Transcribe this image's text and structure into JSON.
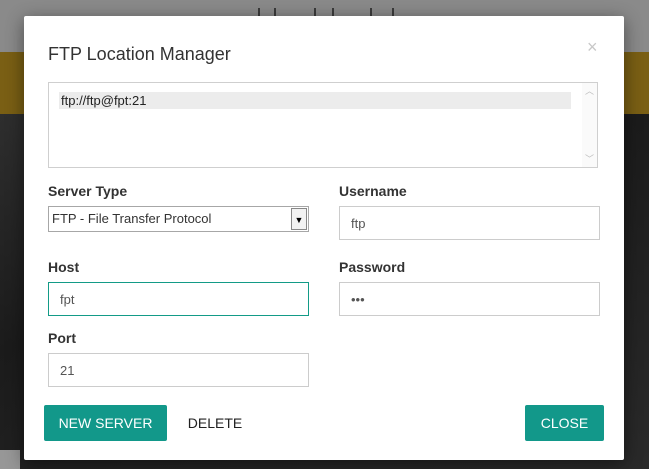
{
  "modal": {
    "title": "FTP Location Manager",
    "close_glyph": "×"
  },
  "locations": [
    "ftp://ftp@fpt:21"
  ],
  "form": {
    "server_type": {
      "label": "Server Type",
      "selected": "FTP - File Transfer Protocol"
    },
    "username": {
      "label": "Username",
      "value": "ftp"
    },
    "host": {
      "label": "Host",
      "value": "fpt"
    },
    "password": {
      "label": "Password",
      "value": "•••"
    },
    "port": {
      "label": "Port",
      "value": "21"
    }
  },
  "buttons": {
    "new_server": "NEW SERVER",
    "delete": "DELETE",
    "close": "CLOSE"
  },
  "colors": {
    "accent": "#12988a",
    "focus_border": "#139b87"
  },
  "icons": {
    "close": "close-icon",
    "scroll_up": "chevron-up-icon",
    "scroll_down": "chevron-down-icon",
    "select_dropdown": "dropdown-arrow-icon"
  }
}
